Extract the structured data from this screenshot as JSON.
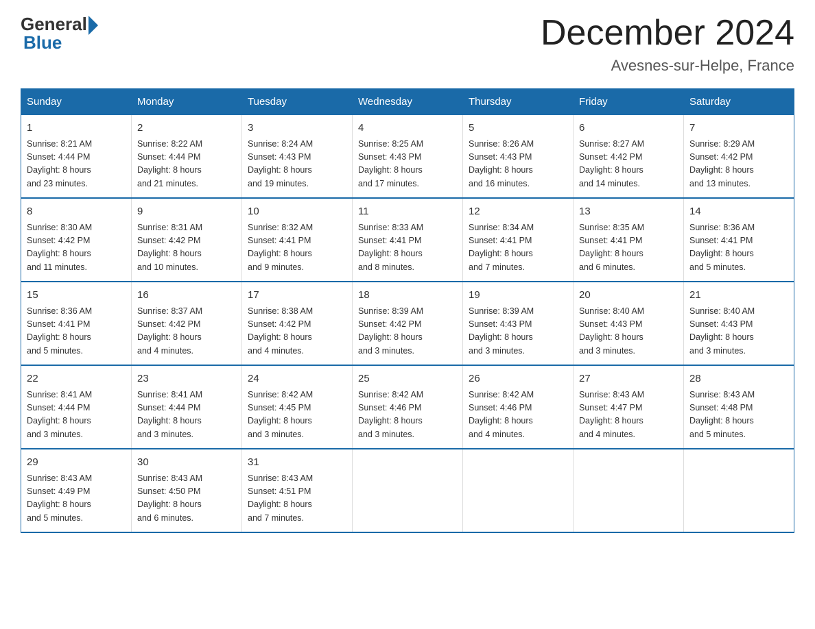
{
  "header": {
    "logo_general": "General",
    "logo_blue": "Blue",
    "main_title": "December 2024",
    "subtitle": "Avesnes-sur-Helpe, France"
  },
  "days_of_week": [
    "Sunday",
    "Monday",
    "Tuesday",
    "Wednesday",
    "Thursday",
    "Friday",
    "Saturday"
  ],
  "weeks": [
    [
      {
        "day": "1",
        "sunrise": "8:21 AM",
        "sunset": "4:44 PM",
        "daylight": "8 hours and 23 minutes."
      },
      {
        "day": "2",
        "sunrise": "8:22 AM",
        "sunset": "4:44 PM",
        "daylight": "8 hours and 21 minutes."
      },
      {
        "day": "3",
        "sunrise": "8:24 AM",
        "sunset": "4:43 PM",
        "daylight": "8 hours and 19 minutes."
      },
      {
        "day": "4",
        "sunrise": "8:25 AM",
        "sunset": "4:43 PM",
        "daylight": "8 hours and 17 minutes."
      },
      {
        "day": "5",
        "sunrise": "8:26 AM",
        "sunset": "4:43 PM",
        "daylight": "8 hours and 16 minutes."
      },
      {
        "day": "6",
        "sunrise": "8:27 AM",
        "sunset": "4:42 PM",
        "daylight": "8 hours and 14 minutes."
      },
      {
        "day": "7",
        "sunrise": "8:29 AM",
        "sunset": "4:42 PM",
        "daylight": "8 hours and 13 minutes."
      }
    ],
    [
      {
        "day": "8",
        "sunrise": "8:30 AM",
        "sunset": "4:42 PM",
        "daylight": "8 hours and 11 minutes."
      },
      {
        "day": "9",
        "sunrise": "8:31 AM",
        "sunset": "4:42 PM",
        "daylight": "8 hours and 10 minutes."
      },
      {
        "day": "10",
        "sunrise": "8:32 AM",
        "sunset": "4:41 PM",
        "daylight": "8 hours and 9 minutes."
      },
      {
        "day": "11",
        "sunrise": "8:33 AM",
        "sunset": "4:41 PM",
        "daylight": "8 hours and 8 minutes."
      },
      {
        "day": "12",
        "sunrise": "8:34 AM",
        "sunset": "4:41 PM",
        "daylight": "8 hours and 7 minutes."
      },
      {
        "day": "13",
        "sunrise": "8:35 AM",
        "sunset": "4:41 PM",
        "daylight": "8 hours and 6 minutes."
      },
      {
        "day": "14",
        "sunrise": "8:36 AM",
        "sunset": "4:41 PM",
        "daylight": "8 hours and 5 minutes."
      }
    ],
    [
      {
        "day": "15",
        "sunrise": "8:36 AM",
        "sunset": "4:41 PM",
        "daylight": "8 hours and 5 minutes."
      },
      {
        "day": "16",
        "sunrise": "8:37 AM",
        "sunset": "4:42 PM",
        "daylight": "8 hours and 4 minutes."
      },
      {
        "day": "17",
        "sunrise": "8:38 AM",
        "sunset": "4:42 PM",
        "daylight": "8 hours and 4 minutes."
      },
      {
        "day": "18",
        "sunrise": "8:39 AM",
        "sunset": "4:42 PM",
        "daylight": "8 hours and 3 minutes."
      },
      {
        "day": "19",
        "sunrise": "8:39 AM",
        "sunset": "4:43 PM",
        "daylight": "8 hours and 3 minutes."
      },
      {
        "day": "20",
        "sunrise": "8:40 AM",
        "sunset": "4:43 PM",
        "daylight": "8 hours and 3 minutes."
      },
      {
        "day": "21",
        "sunrise": "8:40 AM",
        "sunset": "4:43 PM",
        "daylight": "8 hours and 3 minutes."
      }
    ],
    [
      {
        "day": "22",
        "sunrise": "8:41 AM",
        "sunset": "4:44 PM",
        "daylight": "8 hours and 3 minutes."
      },
      {
        "day": "23",
        "sunrise": "8:41 AM",
        "sunset": "4:44 PM",
        "daylight": "8 hours and 3 minutes."
      },
      {
        "day": "24",
        "sunrise": "8:42 AM",
        "sunset": "4:45 PM",
        "daylight": "8 hours and 3 minutes."
      },
      {
        "day": "25",
        "sunrise": "8:42 AM",
        "sunset": "4:46 PM",
        "daylight": "8 hours and 3 minutes."
      },
      {
        "day": "26",
        "sunrise": "8:42 AM",
        "sunset": "4:46 PM",
        "daylight": "8 hours and 4 minutes."
      },
      {
        "day": "27",
        "sunrise": "8:43 AM",
        "sunset": "4:47 PM",
        "daylight": "8 hours and 4 minutes."
      },
      {
        "day": "28",
        "sunrise": "8:43 AM",
        "sunset": "4:48 PM",
        "daylight": "8 hours and 5 minutes."
      }
    ],
    [
      {
        "day": "29",
        "sunrise": "8:43 AM",
        "sunset": "4:49 PM",
        "daylight": "8 hours and 5 minutes."
      },
      {
        "day": "30",
        "sunrise": "8:43 AM",
        "sunset": "4:50 PM",
        "daylight": "8 hours and 6 minutes."
      },
      {
        "day": "31",
        "sunrise": "8:43 AM",
        "sunset": "4:51 PM",
        "daylight": "8 hours and 7 minutes."
      },
      null,
      null,
      null,
      null
    ]
  ],
  "labels": {
    "sunrise": "Sunrise:",
    "sunset": "Sunset:",
    "daylight": "Daylight:"
  }
}
